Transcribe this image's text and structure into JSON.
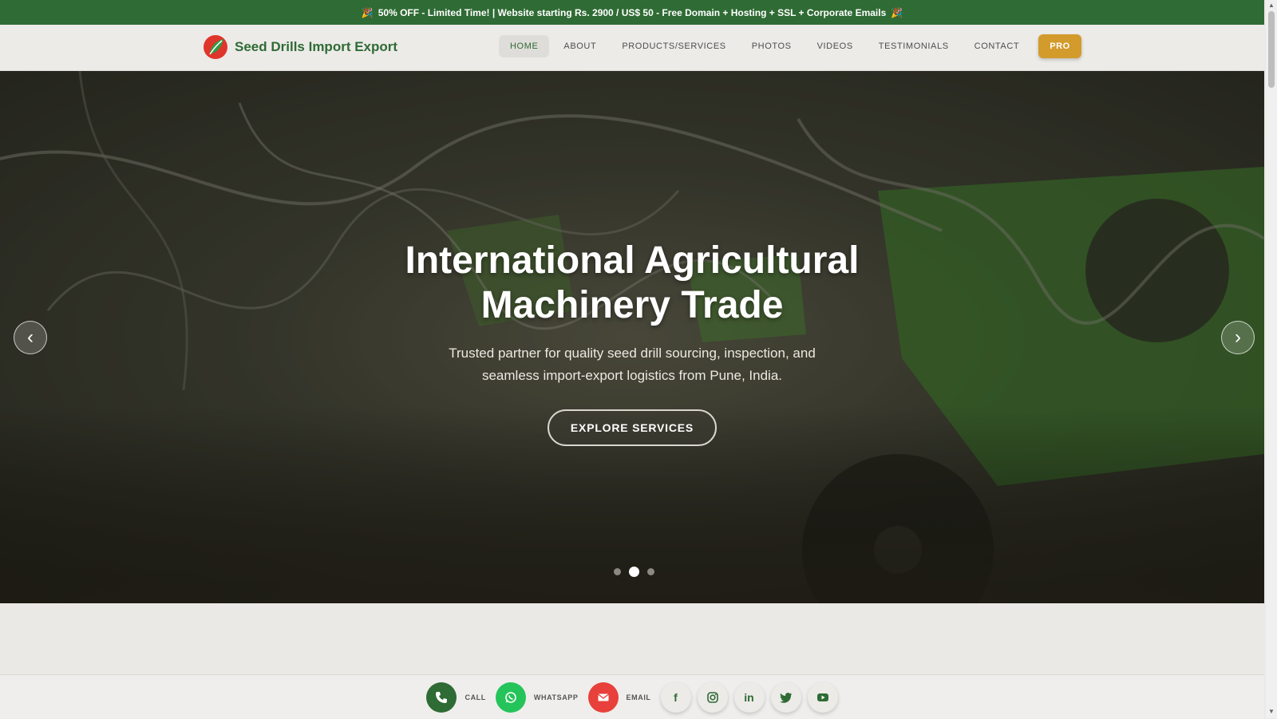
{
  "promo": {
    "text": "50% OFF - Limited Time! | Website starting Rs. 2900 / US$ 50 - Free Domain + Hosting + SSL + Corporate Emails",
    "icon": "party-popper-icon"
  },
  "header": {
    "brand_name": "Seed Drills Import Export",
    "nav": [
      {
        "label": "HOME",
        "active": true
      },
      {
        "label": "ABOUT"
      },
      {
        "label": "PRODUCTS/SERVICES"
      },
      {
        "label": "PHOTOS"
      },
      {
        "label": "VIDEOS"
      },
      {
        "label": "TESTIMONIALS"
      },
      {
        "label": "CONTACT"
      }
    ],
    "pro_label": "PRO"
  },
  "hero": {
    "title": "International Agricultural Machinery Trade",
    "subtitle": "Trusted partner for quality seed drill sourcing, inspection, and seamless import-export logistics from Pune, India.",
    "cta_label": "EXPLORE SERVICES",
    "slides_total": 3,
    "active_slide": 2
  },
  "actionbar": {
    "call_label": "CALL",
    "whatsapp_label": "WHATSAPP",
    "email_label": "EMAIL",
    "social": [
      "facebook-icon",
      "instagram-icon",
      "linkedin-icon",
      "twitter-icon",
      "youtube-icon"
    ]
  },
  "colors": {
    "brand_green": "#2f6b34",
    "pro_gold": "#d39b2c",
    "call_green": "#2f6b34",
    "whatsapp_green": "#25c45a",
    "email_red": "#e8403a"
  }
}
